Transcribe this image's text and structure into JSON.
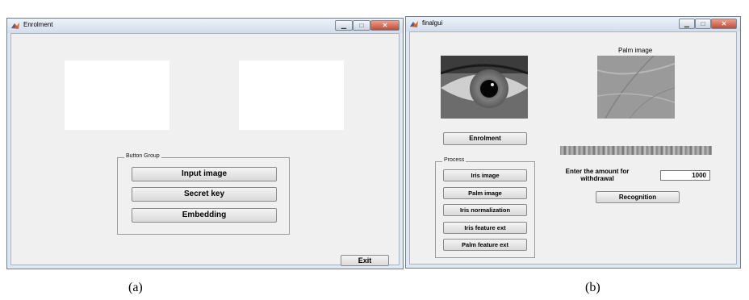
{
  "left_window": {
    "title": "Enrolment",
    "group_label": "Button Group",
    "buttons": [
      "Input image",
      "Secret key",
      "Embedding"
    ],
    "exit_label": "Exit",
    "caption": "(a)"
  },
  "right_window": {
    "title": "finalgui",
    "palm_title": "Palm image",
    "enrolment_label": "Enrolment",
    "process_label": "Process",
    "process_buttons": [
      "Iris image",
      "Palm image",
      "Iris normalization",
      "Iris feature ext",
      "Palm feature ext"
    ],
    "amount_label": "Enter the amount for withdrawal",
    "amount_value": "1000",
    "recognition_label": "Recognition",
    "caption": "(b)"
  }
}
